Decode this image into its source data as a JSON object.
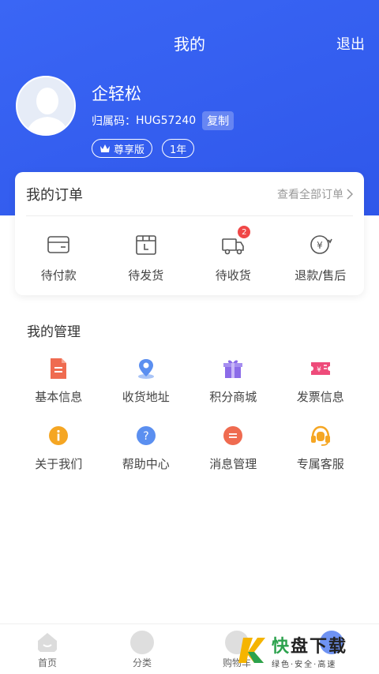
{
  "header": {
    "title": "我的",
    "logout_label": "退出"
  },
  "user": {
    "name": "企轻松",
    "ref_label": "归属码：",
    "ref_code": "HUG57240",
    "copy_label": "复制",
    "vip_label": "尊享版",
    "term_label": "1年"
  },
  "orders": {
    "title": "我的订单",
    "view_all": "查看全部订单",
    "items": [
      {
        "label": "待付款",
        "icon": "wallet-icon"
      },
      {
        "label": "待发货",
        "icon": "package-icon"
      },
      {
        "label": "待收货",
        "icon": "truck-icon",
        "badge": "2"
      },
      {
        "label": "退款/售后",
        "icon": "refund-icon"
      }
    ]
  },
  "management": {
    "title": "我的管理",
    "items": [
      {
        "label": "基本信息",
        "icon": "document-icon",
        "color": "#ef6b50"
      },
      {
        "label": "收货地址",
        "icon": "location-icon",
        "color": "#5b8ff0"
      },
      {
        "label": "积分商城",
        "icon": "gift-icon",
        "color": "#8b6be8"
      },
      {
        "label": "发票信息",
        "icon": "ticket-icon",
        "color": "#ee4b7a"
      },
      {
        "label": "关于我们",
        "icon": "info-icon",
        "color": "#f5a623"
      },
      {
        "label": "帮助中心",
        "icon": "question-icon",
        "color": "#5b8ff0"
      },
      {
        "label": "消息管理",
        "icon": "message-icon",
        "color": "#ef6b50"
      },
      {
        "label": "专属客服",
        "icon": "headset-icon",
        "color": "#f5a623"
      }
    ]
  },
  "tabbar": {
    "items": [
      {
        "label": "首页"
      },
      {
        "label": "分类"
      },
      {
        "label": "购物车"
      },
      {
        "label": ""
      }
    ]
  },
  "watermark": {
    "main_green": "快",
    "main_dark": "盘下载",
    "sub": "绿色·安全·高速"
  }
}
